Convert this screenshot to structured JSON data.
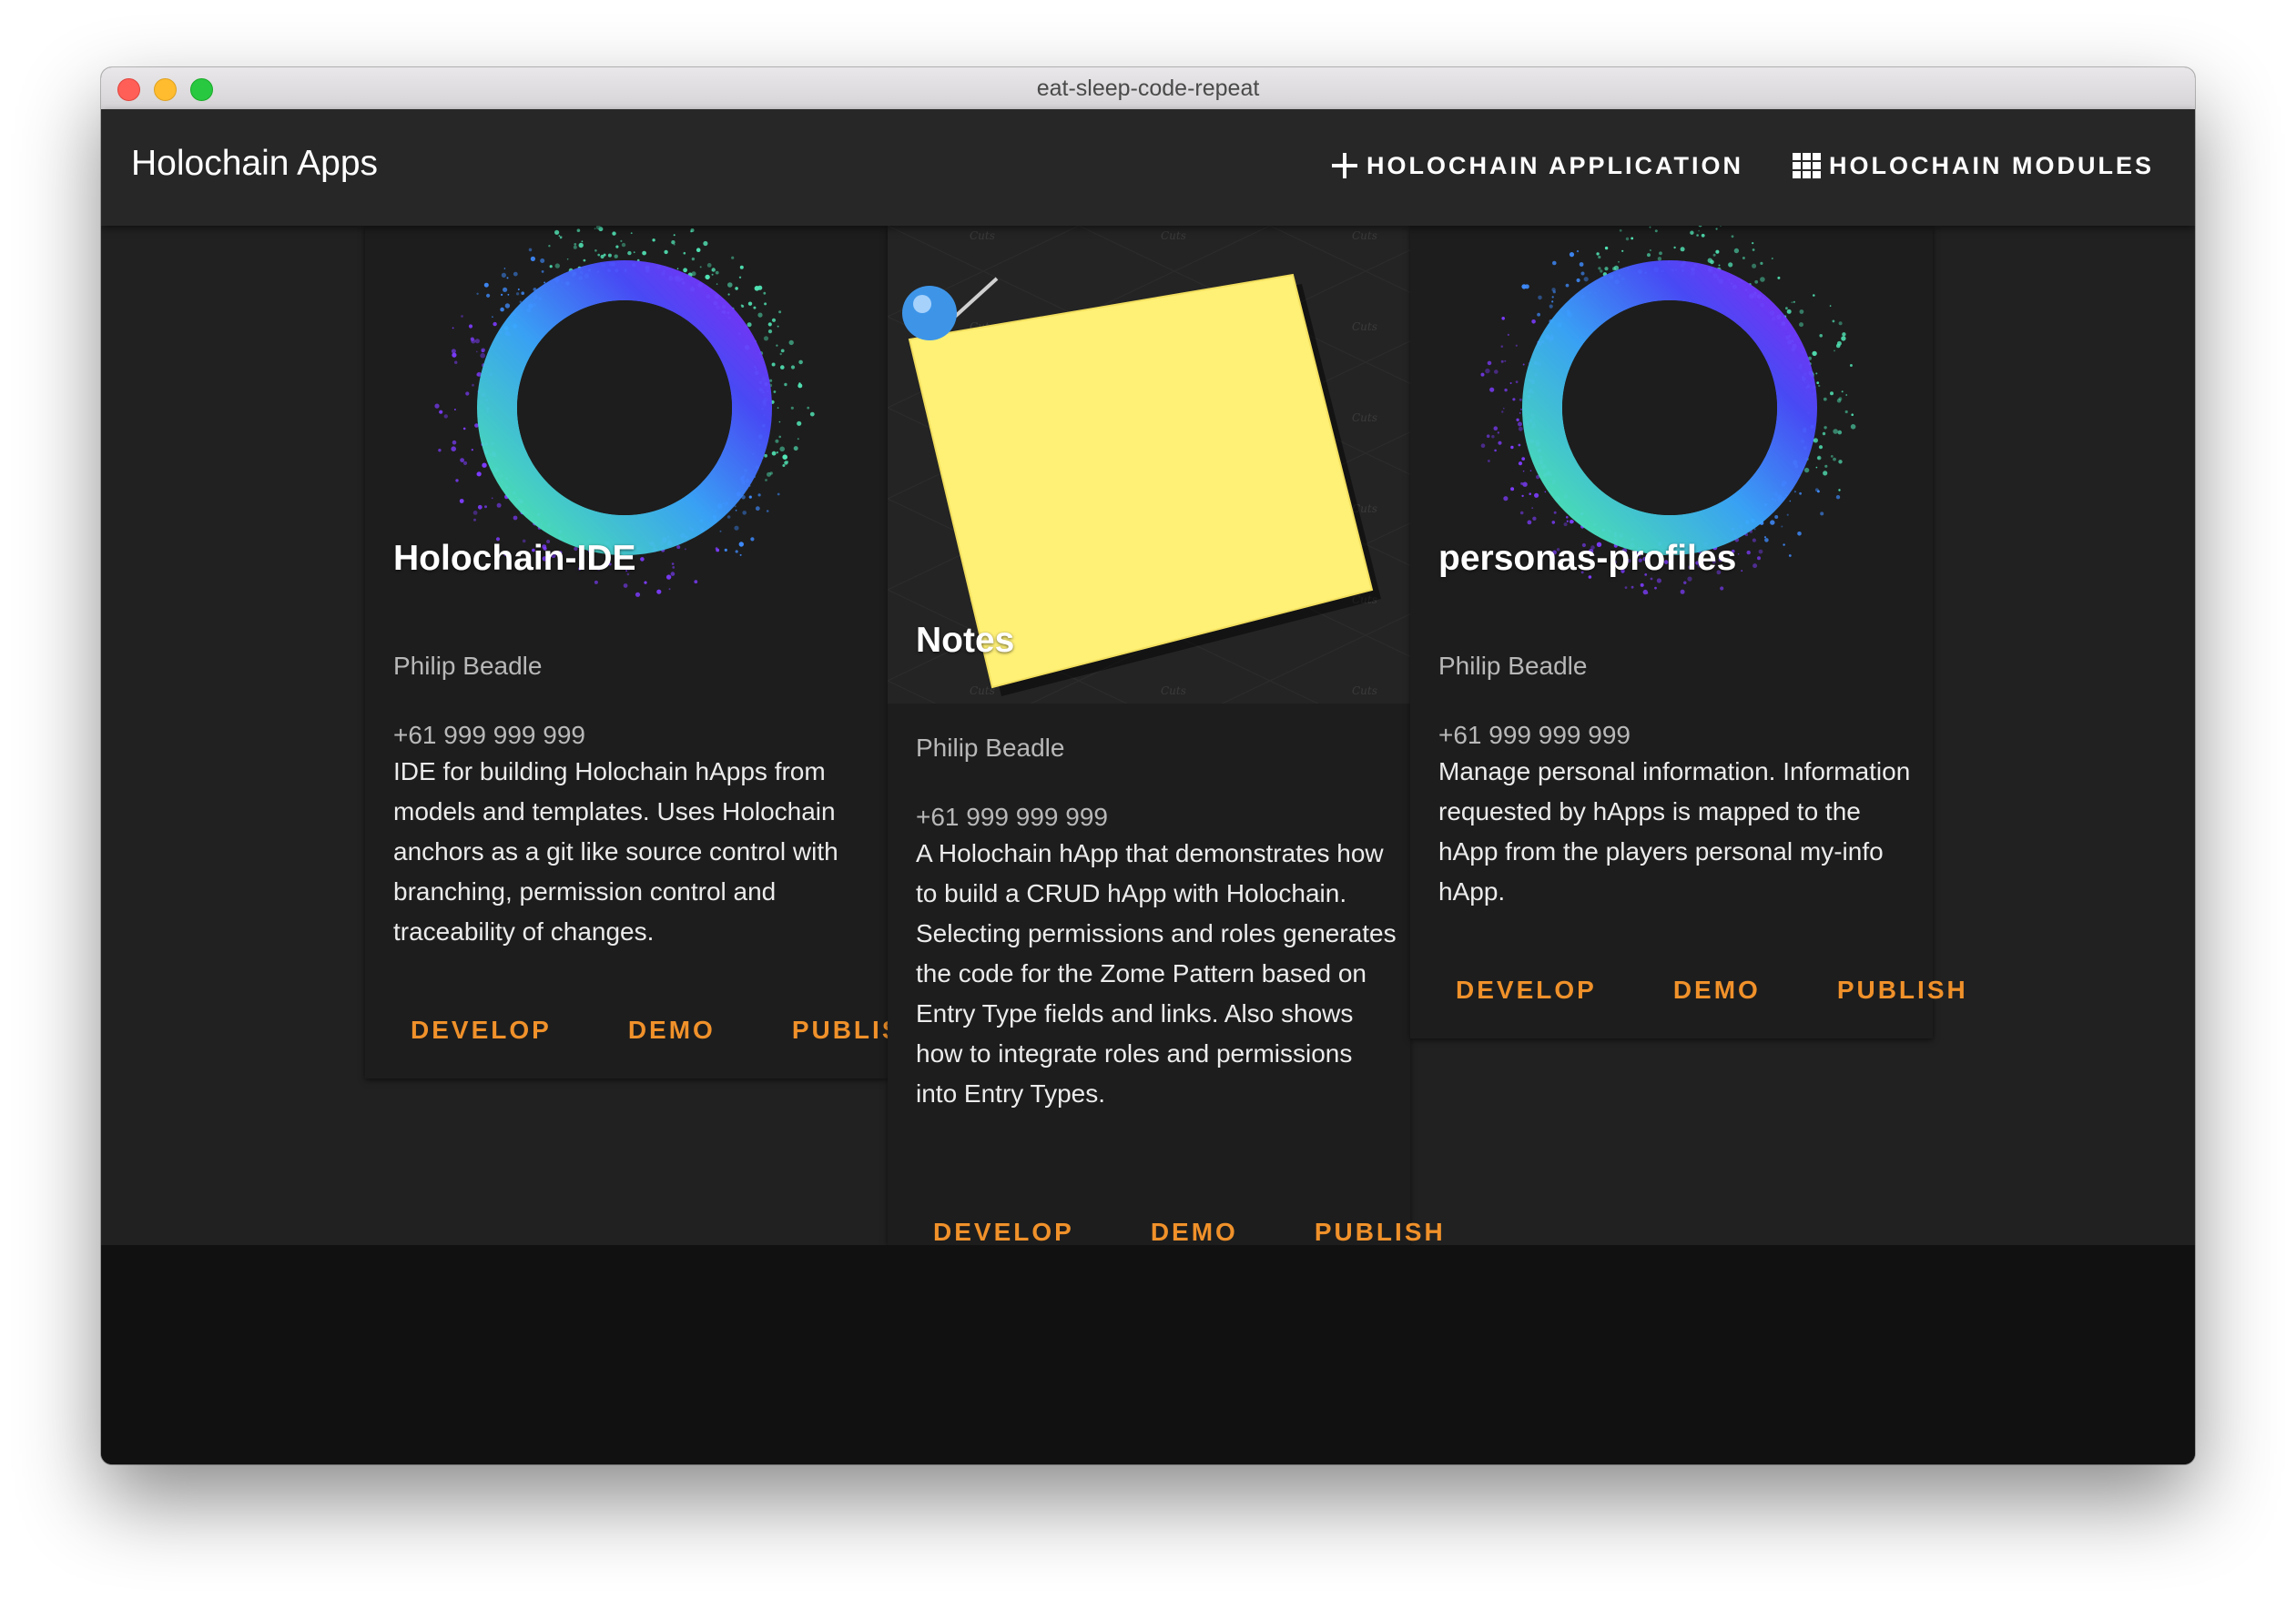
{
  "window": {
    "title": "eat-sleep-code-repeat"
  },
  "appbar": {
    "title": "Holochain Apps",
    "add_app_label": "HOLOCHAIN APPLICATION",
    "modules_label": "HOLOCHAIN MODULES"
  },
  "cards": [
    {
      "title": "Holochain-IDE",
      "owner": "Philip Beadle",
      "phone": "+61 999 999 999",
      "description": "IDE for building Holochain hApps from models and templates. Uses Holochain anchors as a git like source control with branching, permission control and traceability of changes.",
      "actions": {
        "develop": "DEVELOP",
        "demo": "DEMO",
        "publish": "PUBLISH"
      },
      "image": "particle-ring"
    },
    {
      "title": "Notes",
      "owner": "Philip Beadle",
      "phone": "+61 999 999 999",
      "description": "A Holochain hApp that demonstrates how to build a CRUD hApp with Holochain. Selecting permissions and roles generates the code for the Zome Pattern based on Entry Type fields and links. Also shows how to integrate roles and permissions into Entry Types.",
      "actions": {
        "develop": "DEVELOP",
        "demo": "DEMO",
        "publish": "PUBLISH"
      },
      "image": "sticky-note-with-pin"
    },
    {
      "title": "personas-profiles",
      "owner": "Philip Beadle",
      "phone": "+61 999 999 999",
      "description": "Manage personal information. Information requested by hApps is mapped to the hApp from the players personal my-info hApp.",
      "actions": {
        "develop": "DEVELOP",
        "demo": "DEMO",
        "publish": "PUBLISH"
      },
      "image": "particle-ring"
    }
  ],
  "colors": {
    "accent": "#f0912a",
    "appbar": "#272727",
    "background": "#212121",
    "card": "#1d1d1d"
  }
}
